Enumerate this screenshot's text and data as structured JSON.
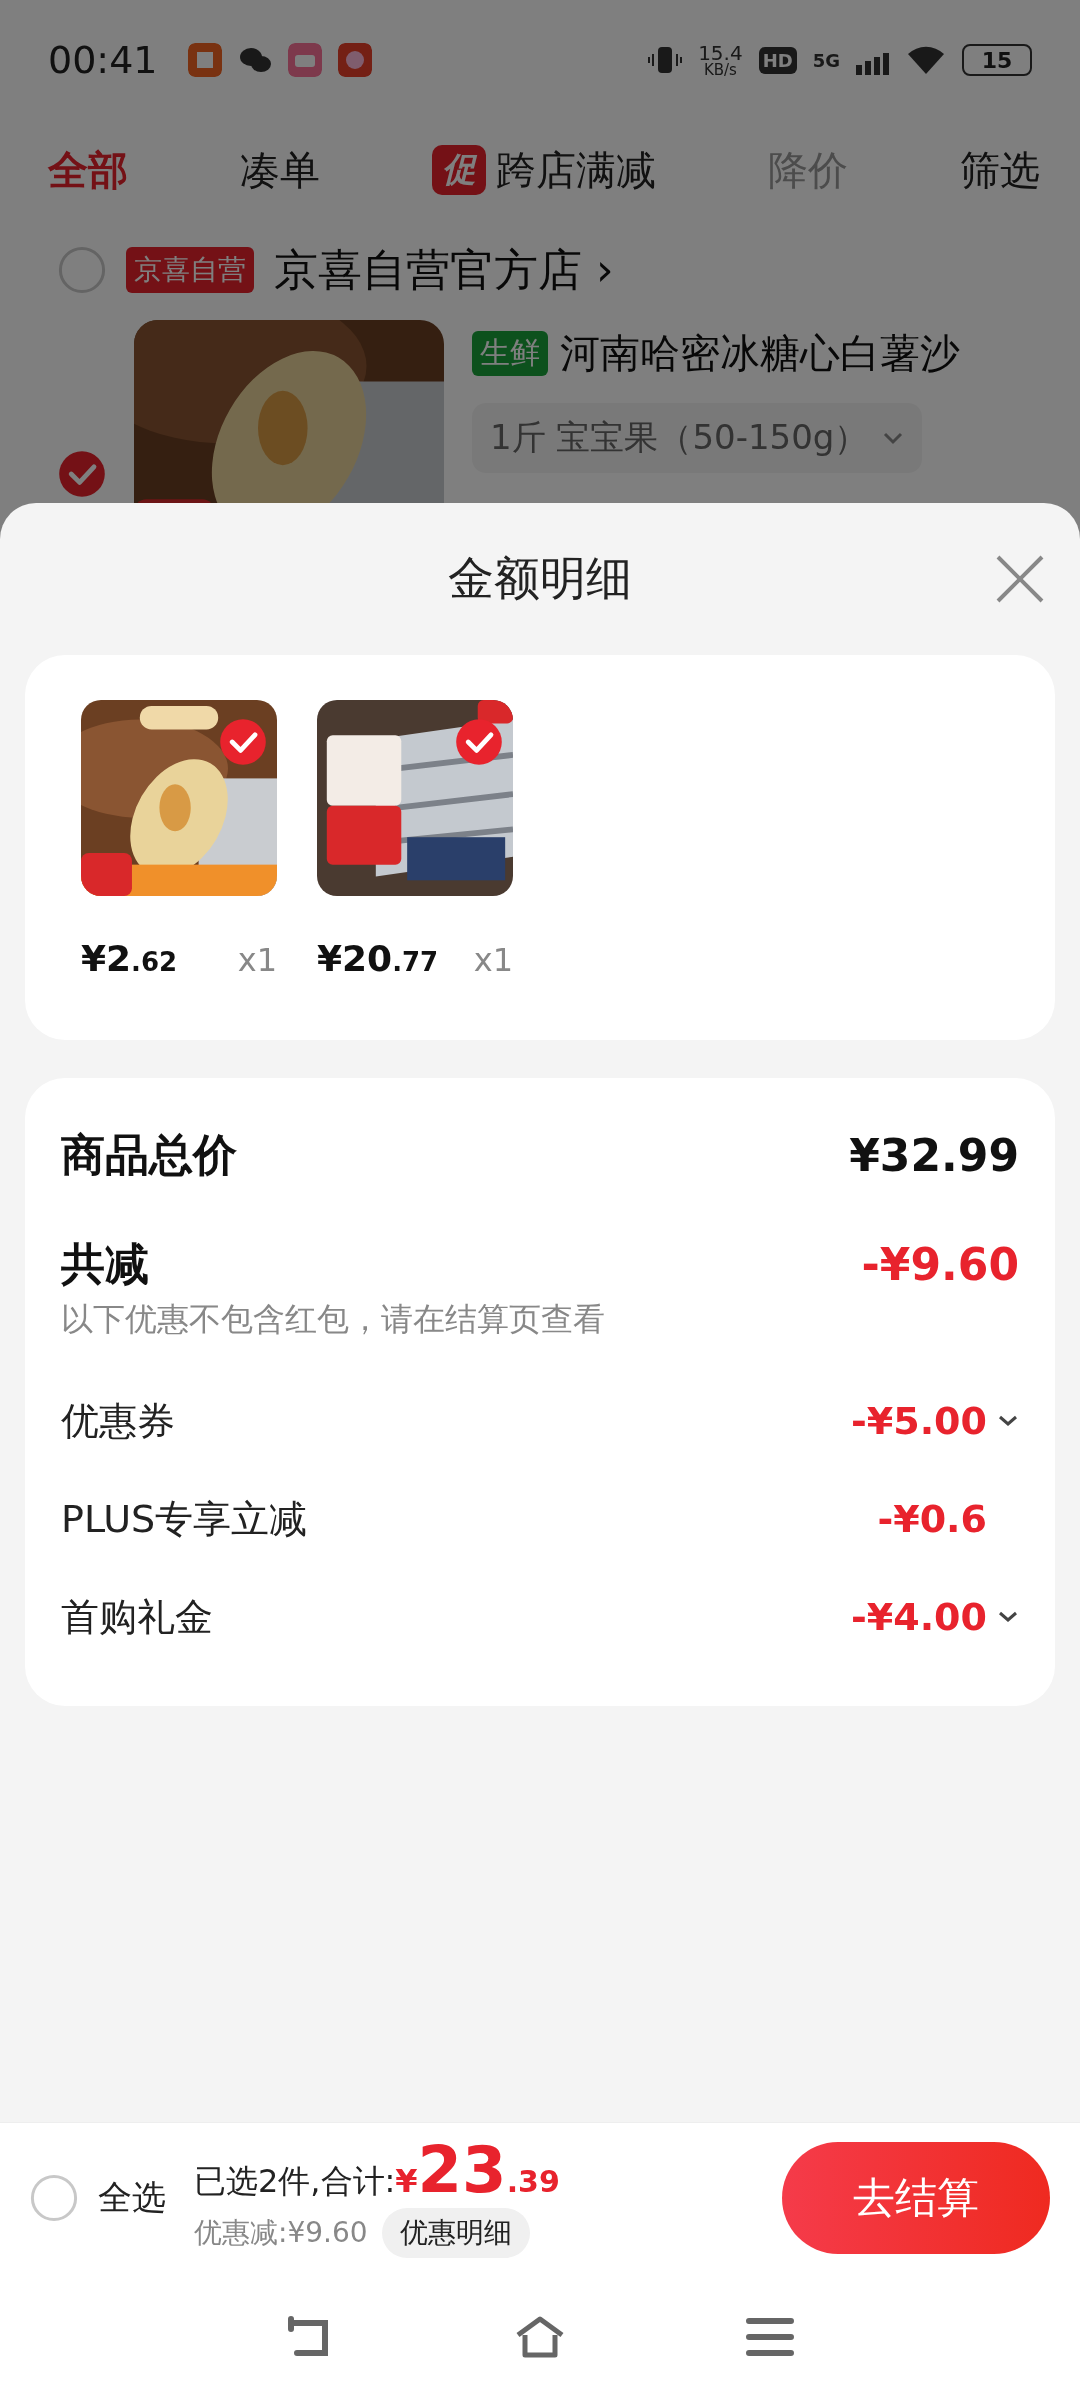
{
  "status_bar": {
    "time": "00:41",
    "net_speed_value": "15.4",
    "net_speed_unit": "KB/s",
    "hd": "HD",
    "network": "5G",
    "battery": "15"
  },
  "tabs": [
    {
      "label": "全部",
      "selected": true,
      "disabled": false
    },
    {
      "label": "凑单",
      "selected": false,
      "disabled": false
    },
    {
      "label": "跨店满减",
      "badge": "促",
      "selected": false,
      "disabled": false
    },
    {
      "label": "降价",
      "selected": false,
      "disabled": true
    },
    {
      "label": "筛选",
      "selected": false,
      "disabled": false
    }
  ],
  "store": {
    "tag": "京喜自营",
    "name": "京喜自营官方店",
    "chevron": "›",
    "selected": false
  },
  "product": {
    "selected": true,
    "tag": "生鲜",
    "title": "河南哈密冰糖心白薯沙",
    "spec": "1斤 宝宝果（50-150g）"
  },
  "sheet": {
    "title": "金额明细",
    "items": [
      {
        "price_int": "¥2",
        "price_dec": ".62",
        "qty": "x1",
        "selected": true
      },
      {
        "price_int": "¥20",
        "price_dec": ".77",
        "qty": "x1",
        "selected": true
      }
    ],
    "total_label": "商品总价",
    "total_value": "¥32.99",
    "discount_label": "共减",
    "discount_value": "-¥9.60",
    "discount_hint": "以下优惠不包含红包，请在结算页查看",
    "rows": [
      {
        "label": "优惠券",
        "value": "-¥5.00",
        "expandable": true
      },
      {
        "label": "PLUS专享立减",
        "value": "-¥0.6",
        "expandable": false
      },
      {
        "label": "首购礼金",
        "value": "-¥4.00",
        "expandable": true
      }
    ]
  },
  "checkout": {
    "select_all_label": "全选",
    "select_all": false,
    "selected_text": "已选2件,合计:",
    "currency": "¥",
    "total_int": "23",
    "total_dec": ".39",
    "saving": "优惠减:¥9.60",
    "detail_button": "优惠明细",
    "checkout_button": "去结算"
  }
}
